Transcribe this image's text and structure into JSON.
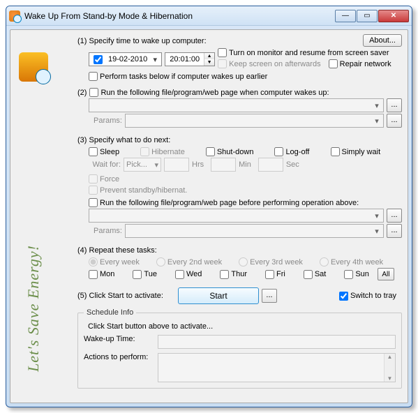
{
  "window": {
    "title": "Wake Up From Stand-by Mode & Hibernation"
  },
  "about": "About...",
  "slogan": "Let's Save Energy!",
  "s1": {
    "heading": "(1) Specify time to wake up computer:",
    "date": "19-02-2010",
    "time": "20:01:00",
    "monitor": "Turn on monitor and resume from screen saver",
    "keep_screen": "Keep screen on afterwards",
    "repair": "Repair network",
    "earlier": "Perform tasks below if computer wakes up earlier"
  },
  "s2": {
    "heading": "Run the following file/program/web page when computer wakes up:",
    "num": "(2)",
    "params": "Params:"
  },
  "s3": {
    "heading": "(3) Specify what to do next:",
    "sleep": "Sleep",
    "hibernate": "Hibernate",
    "shutdown": "Shut-down",
    "logoff": "Log-off",
    "simply": "Simply wait",
    "waitfor": "Wait for:",
    "pick": "Pick...",
    "hrs": "Hrs",
    "min": "Min",
    "sec": "Sec",
    "force": "Force",
    "prevent": "Prevent standby/hibernat.",
    "run_before": "Run the following file/program/web page before performing operation above:",
    "params": "Params:"
  },
  "s4": {
    "heading": "(4) Repeat these tasks:",
    "w1": "Every week",
    "w2": "Every 2nd week",
    "w3": "Every 3rd week",
    "w4": "Every 4th week",
    "mon": "Mon",
    "tue": "Tue",
    "wed": "Wed",
    "thur": "Thur",
    "fri": "Fri",
    "sat": "Sat",
    "sun": "Sun",
    "all": "All"
  },
  "s5": {
    "heading": "(5) Click Start to activate:",
    "start": "Start",
    "tray": "Switch to tray"
  },
  "sched": {
    "legend": "Schedule Info",
    "hint": "Click Start button above to activate...",
    "wake": "Wake-up Time:",
    "actions": "Actions to perform:"
  }
}
